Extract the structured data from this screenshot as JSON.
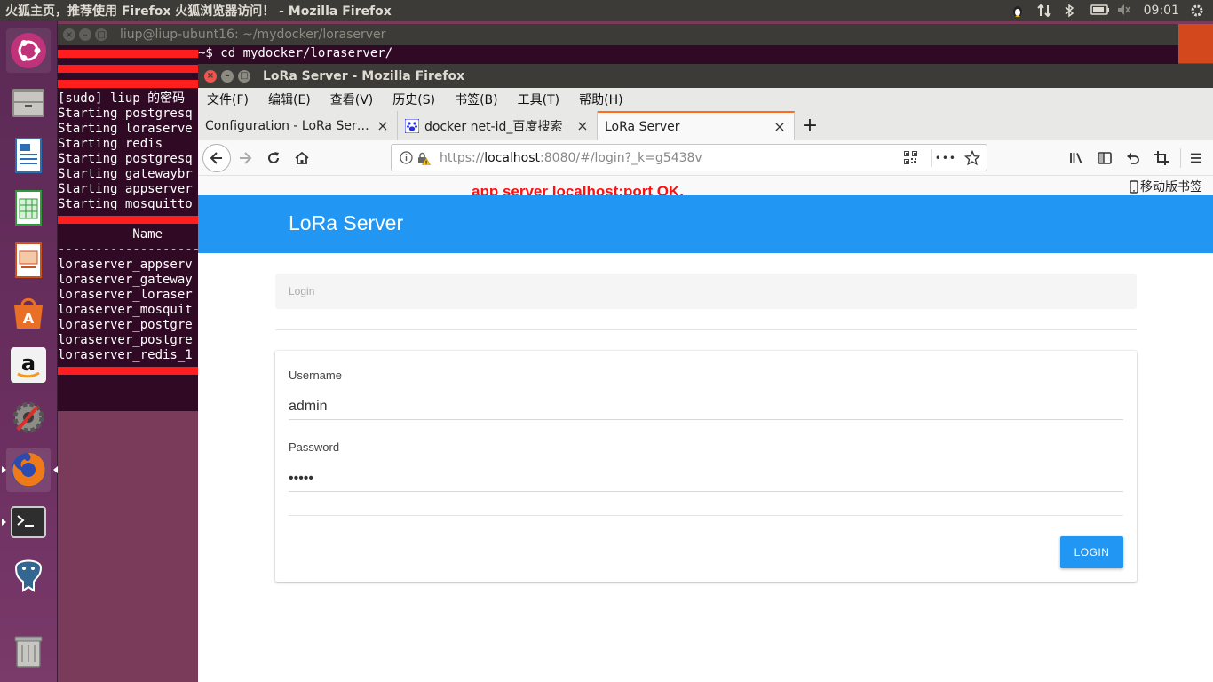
{
  "top_panel": {
    "window_title": "火狐主页，推荐使用 Firefox 火狐浏览器访问！ - Mozilla Firefox",
    "clock": "09:01",
    "icons": [
      "tux-icon",
      "network-icon",
      "bluetooth-icon",
      "battery-icon",
      "volume-icon",
      "gear-icon"
    ]
  },
  "launcher": {
    "items": [
      "ubuntu-dash-icon",
      "files-icon",
      "writer-icon",
      "calc-icon",
      "impress-icon",
      "software-center-icon",
      "amazon-icon",
      "system-settings-icon",
      "firefox-icon",
      "terminal-icon",
      "postgres-icon",
      "trash-icon"
    ]
  },
  "terminal": {
    "title": "liup@liup-ubunt16: ~/mydocker/loraserver",
    "lines": [
      {
        "pre": "",
        "text": "~$ cd mydocker/loraserver/"
      },
      {
        "pre": "",
        "text": ""
      },
      {
        "pre": "",
        "text": ""
      },
      {
        "pre": "",
        "text": "[sudo] liup 的密码"
      },
      {
        "pre": "",
        "text": "Starting postgresq"
      },
      {
        "pre": "",
        "text": "Starting loraserve"
      },
      {
        "pre": "",
        "text": "Starting redis"
      },
      {
        "pre": "",
        "text": "Starting postgresq"
      },
      {
        "pre": "",
        "text": "Starting gatewaybr"
      },
      {
        "pre": "",
        "text": "Starting appserver"
      },
      {
        "pre": "",
        "text": "Starting mosquitto"
      },
      {
        "pre": "",
        "text": ""
      },
      {
        "pre": "",
        "text": "          Name"
      },
      {
        "pre": "",
        "text": "--------------------"
      },
      {
        "pre": "",
        "text": "loraserver_appserv"
      },
      {
        "pre": "",
        "text": "loraserver_gateway"
      },
      {
        "pre": "",
        "text": "loraserver_loraser"
      },
      {
        "pre": "",
        "text": "loraserver_mosquit"
      },
      {
        "pre": "",
        "text": "loraserver_postgre"
      },
      {
        "pre": "",
        "text": "loraserver_postgre"
      },
      {
        "pre": "",
        "text": "loraserver_redis_1"
      },
      {
        "pre": "",
        "text": ""
      }
    ]
  },
  "firefox": {
    "title": "LoRa Server - Mozilla Firefox",
    "menu": [
      "文件(F)",
      "编辑(E)",
      "查看(V)",
      "历史(S)",
      "书签(B)",
      "工具(T)",
      "帮助(H)"
    ],
    "tabs": [
      {
        "label": "Configuration - LoRa Server",
        "favicon": ""
      },
      {
        "label": "docker net-id_百度搜索",
        "favicon": "baidu-paw-icon"
      },
      {
        "label": "LoRa Server",
        "favicon": ""
      }
    ],
    "new_tab": "+",
    "url": {
      "scheme": "https://",
      "host": "localhost",
      "rest": ":8080/#/login?_k=g5438v"
    },
    "url_menu": "•••",
    "mobile_bookmarks": "移动版书签",
    "annotation": "app server localhost:port OK."
  },
  "page": {
    "app_title": "LoRa Server",
    "breadcrumb": "Login",
    "username_label": "Username",
    "username_value": "admin",
    "password_label": "Password",
    "password_value": "admin",
    "login_button": "LOGIN"
  },
  "colors": {
    "header_blue": "#2196f3",
    "terminal_bg": "#300a24",
    "annotation_red": "#ff1010"
  }
}
